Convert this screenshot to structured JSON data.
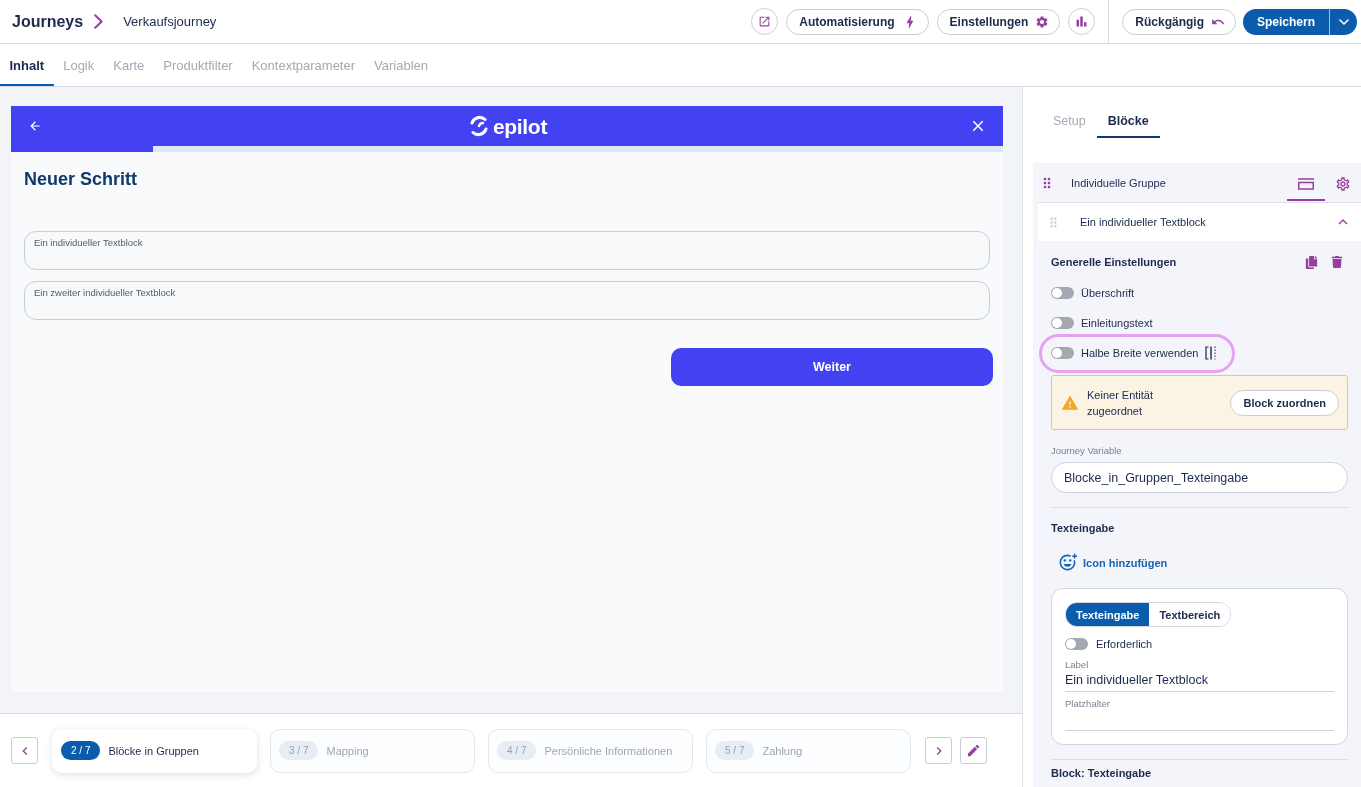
{
  "header": {
    "title": "Journeys",
    "page": "Verkaufsjourney",
    "automation_button": "Automatisierung",
    "settings_button": "Einstellungen",
    "undo_button": "Rückgängig",
    "save_button": "Speichern"
  },
  "tabs": [
    {
      "label": "Inhalt",
      "selected": true
    },
    {
      "label": "Logik",
      "selected": false
    },
    {
      "label": "Karte",
      "selected": false
    },
    {
      "label": "Produktfilter",
      "selected": false
    },
    {
      "label": "Kontextparameter",
      "selected": false
    },
    {
      "label": "Variablen",
      "selected": false
    }
  ],
  "preview": {
    "logo": "epilot",
    "progress": {
      "level": 0.143
    },
    "title": "Neuer Schritt",
    "fields": [
      {
        "label": "Ein individueller Textblock"
      },
      {
        "label": "Ein zweiter individueller Textblock"
      }
    ],
    "next_button": "Weiter"
  },
  "steps": [
    {
      "badge": "2 / 7",
      "label": "Blöcke in Gruppen",
      "selected": true
    },
    {
      "badge": "3 / 7",
      "label": "Mapping",
      "selected": false
    },
    {
      "badge": "4 / 7",
      "label": "Persönliche Informationen",
      "selected": false
    },
    {
      "badge": "5 / 7",
      "label": "Zahlung",
      "selected": false
    }
  ],
  "panel": {
    "tabs": [
      {
        "label": "Setup",
        "selected": false
      },
      {
        "label": "Blöcke",
        "selected": true
      }
    ],
    "group": {
      "title": "Individuelle Gruppe",
      "views": [
        {
          "selected": true
        },
        {
          "selected": false
        }
      ]
    },
    "block": {
      "title": "Ein individueller Textblock",
      "expanded": true
    },
    "general": {
      "title": "Generelle Einstellungen",
      "toggles": [
        {
          "label": "Überschrift",
          "kind": "plain",
          "on": false,
          "highlighted": false
        },
        {
          "label": "Einleitungstext",
          "kind": "plain",
          "on": false,
          "highlighted": false
        },
        {
          "label": "Halbe Breite verwenden",
          "kind": "layout",
          "on": false,
          "highlighted": true
        }
      ]
    },
    "warning": {
      "text": "Keiner Entität zugeordnet",
      "button": "Block zuordnen"
    },
    "variable": {
      "label": "Journey Variable",
      "value": "Blocke_in_Gruppen_Texteingabe"
    },
    "input_section": {
      "title": "Texteingabe",
      "add_icon_button": "Icon hinzufügen",
      "modes": [
        {
          "label": "Texteingabe",
          "selected": true
        },
        {
          "label": "Textbereich",
          "selected": false
        }
      ],
      "required": {
        "label": "Erforderlich",
        "on": false
      },
      "fields": [
        {
          "label": "Label",
          "value": "Ein individueller Textblock"
        },
        {
          "label": "Platzhalter"
        }
      ]
    },
    "next_section": "Block: Texteingabe"
  }
}
